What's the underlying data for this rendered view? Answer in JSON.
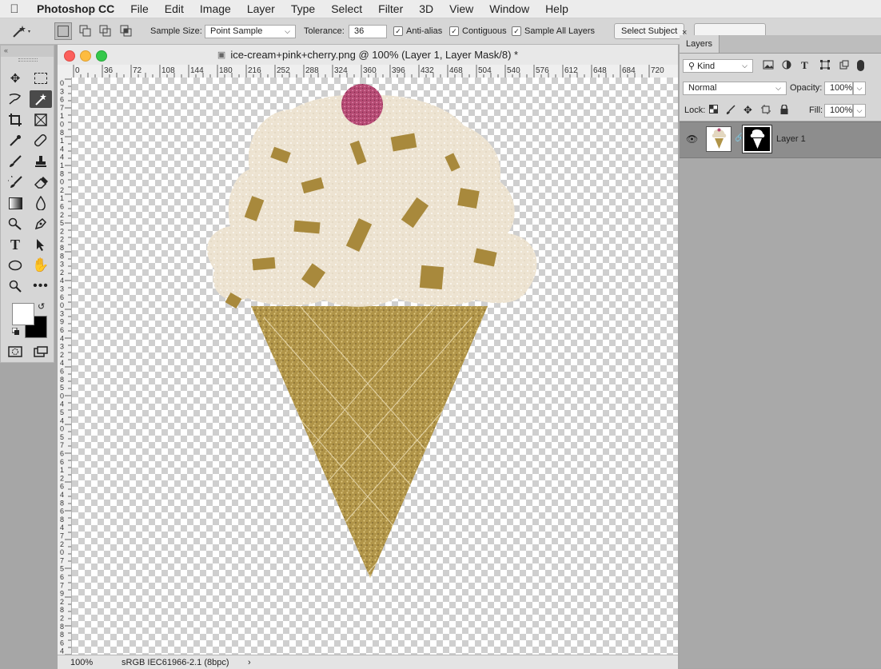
{
  "menubar": {
    "apple_icon": "apple-logo",
    "app_name": "Photoshop CC",
    "items": [
      "File",
      "Edit",
      "Image",
      "Layer",
      "Type",
      "Select",
      "Filter",
      "3D",
      "View",
      "Window",
      "Help"
    ]
  },
  "options": {
    "sample_size_label": "Sample Size:",
    "sample_size_value": "Point Sample",
    "tolerance_label": "Tolerance:",
    "tolerance_value": "36",
    "anti_alias": "Anti-alias",
    "contiguous": "Contiguous",
    "sample_all_layers": "Sample All Layers",
    "select_subject": "Select Subject"
  },
  "document": {
    "title": "ice-cream+pink+cherry.png @ 100% (Layer 1, Layer Mask/8) *",
    "zoom": "100%",
    "color_profile": "sRGB IEC61966-2.1 (8bpc)",
    "status_arrow": "›",
    "ruler_h": [
      "0",
      "36",
      "72",
      "108",
      "144",
      "180",
      "216",
      "252",
      "288",
      "324",
      "360",
      "396",
      "432",
      "468",
      "504",
      "540",
      "576",
      "612",
      "648",
      "684",
      "720"
    ],
    "ruler_v": [
      "0",
      "3",
      "6",
      "7",
      "1",
      "0",
      "8",
      "1",
      "4",
      "4",
      "1",
      "8",
      "0",
      "2",
      "1",
      "6",
      "2",
      "5",
      "2",
      "2",
      "8",
      "8",
      "3",
      "2",
      "4",
      "3",
      "6",
      "0",
      "3",
      "9",
      "6",
      "4",
      "3",
      "2",
      "4",
      "6",
      "8",
      "5",
      "0",
      "4",
      "5",
      "4",
      "0",
      "5",
      "7",
      "6",
      "6",
      "1",
      "2",
      "6",
      "4",
      "8",
      "6",
      "8",
      "4",
      "7",
      "2",
      "0",
      "7",
      "5",
      "6",
      "7",
      "9",
      "2",
      "8",
      "2",
      "8",
      "8",
      "6",
      "4"
    ]
  },
  "layers_panel": {
    "tab": "Layers",
    "close_glyph": "×",
    "kind_label": "Kind",
    "blend_mode": "Normal",
    "opacity_label": "Opacity:",
    "opacity_value": "100%",
    "lock_label": "Lock:",
    "fill_label": "Fill:",
    "fill_value": "100%",
    "layer_name": "Layer 1"
  },
  "colors": {
    "cream": "#efe6d6",
    "gold": "#b59a4e",
    "cherry": "#b54a73",
    "sprinkle": "#a58a36"
  }
}
